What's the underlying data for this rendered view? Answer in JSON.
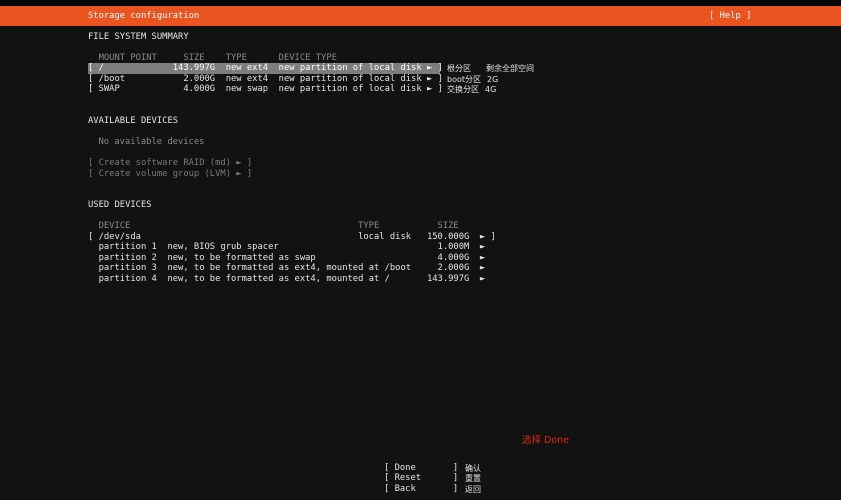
{
  "header": {
    "title": "Storage configuration",
    "help": "[ Help ]"
  },
  "fs_summary": {
    "heading": "FILE SYSTEM SUMMARY",
    "columns": [
      "MOUNT POINT",
      "SIZE",
      "TYPE",
      "DEVICE TYPE"
    ],
    "rows": [
      {
        "mount": "/",
        "size": "143.997G",
        "type": "new ext4",
        "device_type": "new partition of local disk",
        "arrow": "►",
        "note1": "根分区",
        "note2": "剩余全部空间",
        "selected": true
      },
      {
        "mount": "/boot",
        "size": "2.000G",
        "type": "new ext4",
        "device_type": "new partition of local disk",
        "arrow": "►",
        "note1": "boot分区",
        "note2": "2G"
      },
      {
        "mount": "SWAP",
        "size": "4.000G",
        "type": "new swap",
        "device_type": "new partition of local disk",
        "arrow": "►",
        "note1": "交换分区",
        "note2": "4G"
      }
    ]
  },
  "available": {
    "heading": "AVAILABLE DEVICES",
    "empty": "No available devices",
    "actions": [
      "[ Create software RAID (md) ► ]",
      "[ Create volume group (LVM) ► ]"
    ]
  },
  "used": {
    "heading": "USED DEVICES",
    "columns": [
      "DEVICE",
      "TYPE",
      "SIZE"
    ],
    "disk": {
      "name": "/dev/sda",
      "type": "local disk",
      "size": "150.000G",
      "arrow": "►"
    },
    "partitions": [
      {
        "name": "partition 1",
        "desc": "new, BIOS grub spacer",
        "size": "1.000M",
        "arrow": "►"
      },
      {
        "name": "partition 2",
        "desc": "new, to be formatted as swap",
        "size": "4.000G",
        "arrow": "►"
      },
      {
        "name": "partition 3",
        "desc": "new, to be formatted as ext4, mounted at /boot",
        "size": "2.000G",
        "arrow": "►"
      },
      {
        "name": "partition 4",
        "desc": "new, to be formatted as ext4, mounted at /",
        "size": "143.997G",
        "arrow": "►"
      }
    ]
  },
  "annotation": "选择  Done",
  "buttons": [
    {
      "label": "Done",
      "note": "确认"
    },
    {
      "label": "Reset",
      "note": "重置"
    },
    {
      "label": "Back",
      "note": "返回"
    }
  ],
  "colors": {
    "accent": "#e95420",
    "annotation": "#e0241b",
    "background": "#121212"
  }
}
